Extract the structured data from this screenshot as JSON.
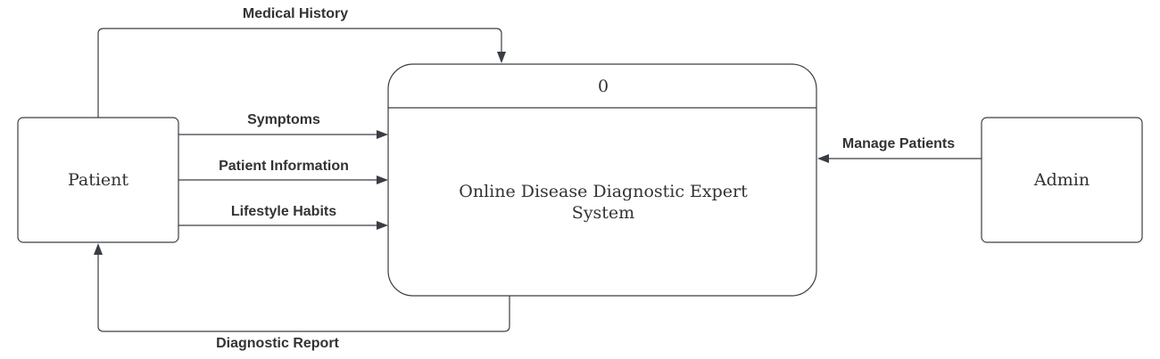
{
  "entities": {
    "patient": "Patient",
    "admin": "Admin"
  },
  "process": {
    "id": "0",
    "name_line1": "Online Disease Diagnostic Expert",
    "name_line2": "System"
  },
  "flows": {
    "medical_history": "Medical History",
    "symptoms": "Symptoms",
    "patient_information": "Patient Information",
    "lifestyle_habits": "Lifestyle Habits",
    "manage_patients": "Manage Patients",
    "diagnostic_report": "Diagnostic Report"
  },
  "colors": {
    "stroke": "#3a3d44",
    "text": "#333333",
    "background": "#ffffff"
  }
}
